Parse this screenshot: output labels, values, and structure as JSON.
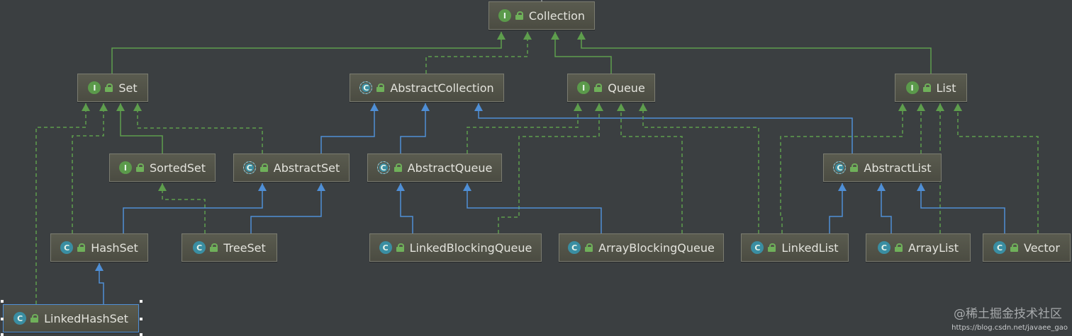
{
  "nodes": [
    {
      "id": "collection",
      "label": "Collection",
      "kind": "I"
    },
    {
      "id": "set",
      "label": "Set",
      "kind": "I"
    },
    {
      "id": "abstractcollection",
      "label": "AbstractCollection",
      "kind": "A"
    },
    {
      "id": "queue",
      "label": "Queue",
      "kind": "I"
    },
    {
      "id": "list",
      "label": "List",
      "kind": "I"
    },
    {
      "id": "sortedset",
      "label": "SortedSet",
      "kind": "I"
    },
    {
      "id": "abstractset",
      "label": "AbstractSet",
      "kind": "A"
    },
    {
      "id": "abstractqueue",
      "label": "AbstractQueue",
      "kind": "A"
    },
    {
      "id": "abstractlist",
      "label": "AbstractList",
      "kind": "A"
    },
    {
      "id": "hashset",
      "label": "HashSet",
      "kind": "C"
    },
    {
      "id": "treeset",
      "label": "TreeSet",
      "kind": "C"
    },
    {
      "id": "linkedblockingqueue",
      "label": "LinkedBlockingQueue",
      "kind": "C"
    },
    {
      "id": "arrayblockingqueue",
      "label": "ArrayBlockingQueue",
      "kind": "C"
    },
    {
      "id": "linkedlist",
      "label": "LinkedList",
      "kind": "C"
    },
    {
      "id": "arraylist",
      "label": "ArrayList",
      "kind": "C"
    },
    {
      "id": "vector",
      "label": "Vector",
      "kind": "C"
    },
    {
      "id": "linkedhashset",
      "label": "LinkedHashSet",
      "kind": "C",
      "selected": true
    }
  ],
  "kind_letters": {
    "I": "I",
    "C": "C",
    "A": "C"
  },
  "colors": {
    "interface_extends": "#5e9e4d",
    "class_extends": "#4f8fd6",
    "implements": "#5e9e4d",
    "background": "#3b3f41"
  },
  "edges": [
    {
      "from": "set",
      "to": "collection",
      "type": "extends-interface"
    },
    {
      "from": "queue",
      "to": "collection",
      "type": "extends-interface"
    },
    {
      "from": "list",
      "to": "collection",
      "type": "extends-interface"
    },
    {
      "from": "abstractcollection",
      "to": "collection",
      "type": "implements"
    },
    {
      "from": "sortedset",
      "to": "set",
      "type": "extends-interface"
    },
    {
      "from": "abstractset",
      "to": "set",
      "type": "implements"
    },
    {
      "from": "hashset",
      "to": "set",
      "type": "implements"
    },
    {
      "from": "linkedhashset",
      "to": "set",
      "type": "implements"
    },
    {
      "from": "abstractset",
      "to": "abstractcollection",
      "type": "extends-class"
    },
    {
      "from": "abstractqueue",
      "to": "abstractcollection",
      "type": "extends-class"
    },
    {
      "from": "abstractlist",
      "to": "abstractcollection",
      "type": "extends-class"
    },
    {
      "from": "abstractqueue",
      "to": "queue",
      "type": "implements"
    },
    {
      "from": "linkedblockingqueue",
      "to": "queue",
      "type": "implements"
    },
    {
      "from": "arrayblockingqueue",
      "to": "queue",
      "type": "implements"
    },
    {
      "from": "linkedlist",
      "to": "queue",
      "type": "implements"
    },
    {
      "from": "abstractlist",
      "to": "list",
      "type": "implements"
    },
    {
      "from": "linkedlist",
      "to": "list",
      "type": "implements"
    },
    {
      "from": "arraylist",
      "to": "list",
      "type": "implements"
    },
    {
      "from": "vector",
      "to": "list",
      "type": "implements"
    },
    {
      "from": "treeset",
      "to": "sortedset",
      "type": "implements"
    },
    {
      "from": "hashset",
      "to": "abstractset",
      "type": "extends-class"
    },
    {
      "from": "treeset",
      "to": "abstractset",
      "type": "extends-class"
    },
    {
      "from": "linkedblockingqueue",
      "to": "abstractqueue",
      "type": "extends-class"
    },
    {
      "from": "arrayblockingqueue",
      "to": "abstractqueue",
      "type": "extends-class"
    },
    {
      "from": "linkedlist",
      "to": "abstractlist",
      "type": "extends-class"
    },
    {
      "from": "arraylist",
      "to": "abstractlist",
      "type": "extends-class"
    },
    {
      "from": "vector",
      "to": "abstractlist",
      "type": "extends-class"
    },
    {
      "from": "linkedhashset",
      "to": "hashset",
      "type": "extends-class"
    }
  ],
  "watermark": {
    "text": "@稀土掘金技术社区",
    "url": "https://blog.csdn.net/javaee_gao"
  }
}
